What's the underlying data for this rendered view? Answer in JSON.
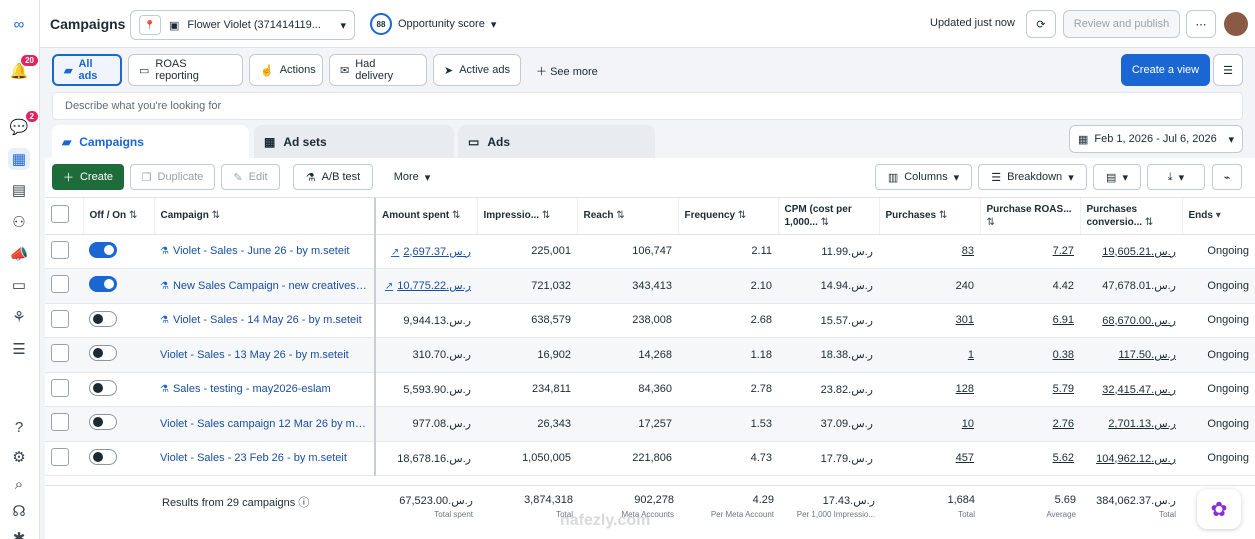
{
  "topbar": {
    "title": "Campaigns",
    "account_name": "Flower Violet (371414119...",
    "opportunity_score": "88",
    "opportunity_label": "Opportunity score",
    "updated": "Updated just now",
    "review_publish": "Review and publish",
    "more_dots": "⋯"
  },
  "rail": {
    "notifications_badge": "20",
    "messages_badge": "2"
  },
  "views": {
    "all_ads": "All ads",
    "roas": "ROAS reporting",
    "actions": "Actions",
    "had_delivery": "Had delivery",
    "active_ads": "Active ads",
    "see_more": "See more",
    "create_view": "Create a view"
  },
  "search": {
    "placeholder": "Describe what you're looking for"
  },
  "tabs": {
    "campaigns": "Campaigns",
    "ad_sets": "Ad sets",
    "ads": "Ads"
  },
  "date_range": "Feb 1, 2026 - Jul 6, 2026",
  "toolbar": {
    "create": "Create",
    "duplicate": "Duplicate",
    "edit": "Edit",
    "ab_test": "A/B test",
    "more": "More",
    "columns": "Columns",
    "breakdown": "Breakdown"
  },
  "columns": {
    "off_on": "Off / On",
    "campaign": "Campaign",
    "amount_spent": "Amount spent",
    "impressions": "Impressio...",
    "reach": "Reach",
    "frequency": "Frequency",
    "cpm": "CPM (cost per 1,000...",
    "purchases": "Purchases",
    "purchase_roas": "Purchase ROAS...",
    "purchases_conv": "Purchases conversio...",
    "ends": "Ends"
  },
  "rows": [
    {
      "name": "Violet - Sales - June 26 - by m.seteit",
      "draft": true,
      "on": true,
      "spent": "ر.س.2,697.37",
      "spent_linked": true,
      "impressions": "225,001",
      "reach": "106,747",
      "frequency": "2.11",
      "cpm": "ر.س.11.99",
      "purchases": "83",
      "roas": "7.27",
      "conv": "ر.س.19,605.21",
      "ends": "Ongoing"
    },
    {
      "name": "New Sales Campaign - new creatives -j...",
      "draft": true,
      "on": true,
      "spent": "ر.س.10,775.22",
      "spent_linked": true,
      "impressions": "721,032",
      "reach": "343,413",
      "frequency": "2.10",
      "cpm": "ر.س.14.94",
      "purchases": "240",
      "roas": "4.42",
      "conv": "ر.س.47,678.01",
      "ends": "Ongoing"
    },
    {
      "name": "Violet - Sales - 14 May 26 - by m.seteit",
      "draft": true,
      "on": false,
      "spent": "ر.س.9,944.13",
      "spent_linked": false,
      "impressions": "638,579",
      "reach": "238,008",
      "frequency": "2.68",
      "cpm": "ر.س.15.57",
      "purchases": "301",
      "roas": "6.91",
      "conv": "ر.س.68,670.00",
      "ends": "Ongoing"
    },
    {
      "name": "Violet - Sales - 13 May 26 - by m.seteit",
      "draft": false,
      "on": false,
      "spent": "ر.س.310.70",
      "spent_linked": false,
      "impressions": "16,902",
      "reach": "14,268",
      "frequency": "1.18",
      "cpm": "ر.س.18.38",
      "purchases": "1",
      "roas": "0.38",
      "conv": "ر.س.117.50",
      "ends": "Ongoing"
    },
    {
      "name": "Sales - testing - may2026-eslam",
      "draft": true,
      "on": false,
      "spent": "ر.س.5,593.90",
      "spent_linked": false,
      "impressions": "234,811",
      "reach": "84,360",
      "frequency": "2.78",
      "cpm": "ر.س.23.82",
      "purchases": "128",
      "roas": "5.79",
      "conv": "ر.س.32,415.47",
      "ends": "Ongoing"
    },
    {
      "name": "Violet - Sales campaign 12 Mar 26 by m.s...",
      "draft": false,
      "on": false,
      "spent": "ر.س.977.08",
      "spent_linked": false,
      "impressions": "26,343",
      "reach": "17,257",
      "frequency": "1.53",
      "cpm": "ر.س.37.09",
      "purchases": "10",
      "roas": "2.76",
      "conv": "ر.س.2,701.13",
      "ends": "Ongoing"
    },
    {
      "name": "Violet - Sales - 23 Feb 26 - by m.seteit",
      "draft": false,
      "on": false,
      "spent": "ر.س.18,678.16",
      "spent_linked": false,
      "impressions": "1,050,005",
      "reach": "221,806",
      "frequency": "4.73",
      "cpm": "ر.س.17.79",
      "purchases": "457",
      "roas": "5.62",
      "conv": "ر.س.104,962.12",
      "ends": "Ongoing"
    }
  ],
  "footer": {
    "results": "Results from 29 campaigns",
    "spent": "ر.س.67,523.00",
    "spent_label": "Total spent",
    "impressions": "3,874,318",
    "impressions_label": "Total",
    "reach": "902,278",
    "reach_label": "Meta Accounts",
    "frequency": "4.29",
    "frequency_label": "Per Meta Account",
    "cpm": "ر.س.17.43",
    "cpm_label": "Per 1,000 Impressio...",
    "purchases": "1,684",
    "purchases_label": "Total",
    "roas": "5.69",
    "roas_label": "Average",
    "conv": "ر.س.384,062.37",
    "conv_label": "Total"
  },
  "watermark": "nafezly.com"
}
